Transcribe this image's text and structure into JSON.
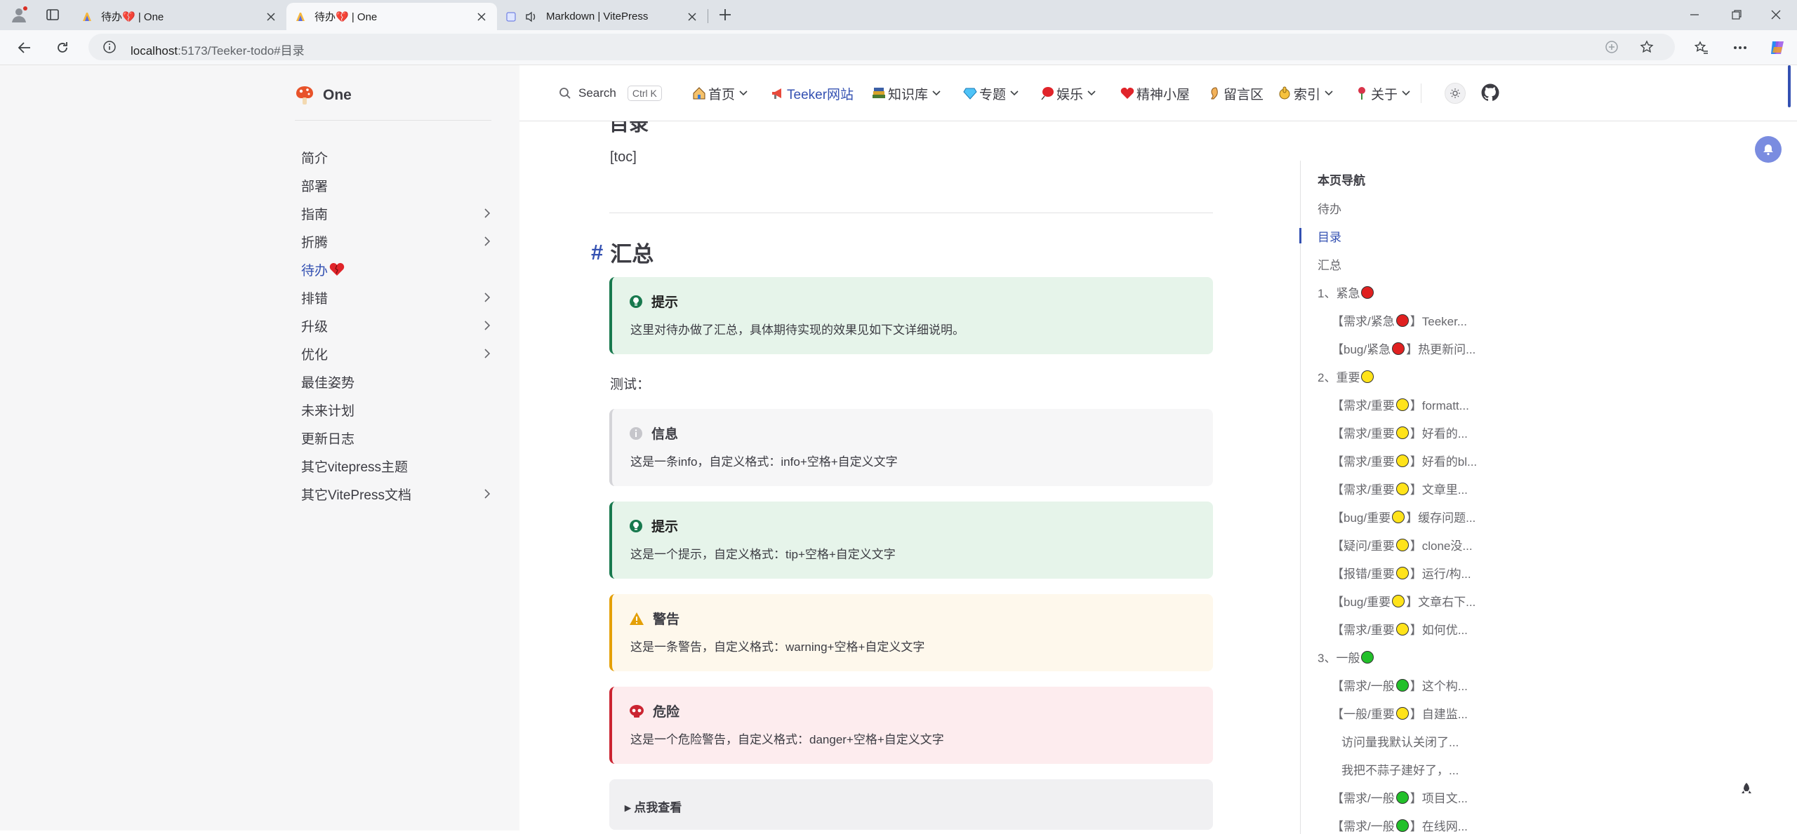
{
  "browser": {
    "tabs": [
      {
        "title": "待办💔 | One",
        "active": false
      },
      {
        "title": "待办💔 | One",
        "active": true
      },
      {
        "title": "Markdown | VitePress",
        "active": false
      }
    ],
    "address": {
      "host": "localhost",
      "path": ":5173/Teeker-todo#目录"
    }
  },
  "site": {
    "name": "One",
    "search_label": "Search",
    "search_kbd": "Ctrl K"
  },
  "nav": [
    {
      "label": "首页",
      "caret": true
    },
    {
      "label": "Teeker网站",
      "caret": false
    },
    {
      "label": "知识库",
      "caret": true
    },
    {
      "label": "专题",
      "caret": true
    },
    {
      "label": "娱乐",
      "caret": true
    },
    {
      "label": "精神小屋",
      "caret": false
    },
    {
      "label": "留言区",
      "caret": false
    },
    {
      "label": "索引",
      "caret": true
    },
    {
      "label": "关于",
      "caret": true
    }
  ],
  "sidebar": [
    {
      "label": "简介",
      "chevron": false
    },
    {
      "label": "部署",
      "chevron": false
    },
    {
      "label": "指南",
      "chevron": true
    },
    {
      "label": "折腾",
      "chevron": true
    },
    {
      "label": "待办",
      "chevron": false,
      "active": true
    },
    {
      "label": "排错",
      "chevron": true
    },
    {
      "label": "升级",
      "chevron": true
    },
    {
      "label": "优化",
      "chevron": true
    },
    {
      "label": "最佳姿势",
      "chevron": false
    },
    {
      "label": "未来计划",
      "chevron": false
    },
    {
      "label": "更新日志",
      "chevron": false
    },
    {
      "label": "其它vitepress主题",
      "chevron": false
    },
    {
      "label": "其它VitePress文档",
      "chevron": true
    }
  ],
  "content": {
    "partial_heading": "目录",
    "toc_placeholder": "[toc]",
    "section_hash": "#",
    "section_title": "汇总",
    "summary_tip": {
      "title": "提示",
      "text": "这里对待办做了汇总，具体期待实现的效果见如下文详细说明。"
    },
    "test_label": "测试：",
    "info": {
      "title": "信息",
      "text": "这是一条info，自定义格式：info+空格+自定义文字"
    },
    "tip": {
      "title": "提示",
      "text": "这是一个提示，自定义格式：tip+空格+自定义文字"
    },
    "warning": {
      "title": "警告",
      "text": "这是一条警告，自定义格式：warning+空格+自定义文字"
    },
    "danger": {
      "title": "危险",
      "text": "这是一个危险警告，自定义格式：danger+空格+自定义文字"
    },
    "details_label": "点我查看"
  },
  "outline": {
    "title": "本页导航",
    "items": [
      {
        "pre": "待办",
        "dot": "",
        "post": "",
        "level": 1
      },
      {
        "pre": "目录",
        "dot": "",
        "post": "",
        "level": 1,
        "active": true
      },
      {
        "pre": "汇总",
        "dot": "",
        "post": "",
        "level": 1
      },
      {
        "pre": "1、紧急",
        "dot": "red",
        "post": "",
        "level": 1
      },
      {
        "pre": "【需求/紧急",
        "dot": "red",
        "post": "】Teeker...",
        "level": 2
      },
      {
        "pre": "【bug/紧急",
        "dot": "red",
        "post": "】热更新问...",
        "level": 2
      },
      {
        "pre": "2、重要",
        "dot": "yellow",
        "post": "",
        "level": 1
      },
      {
        "pre": "【需求/重要",
        "dot": "yellow",
        "post": "】formatt...",
        "level": 2
      },
      {
        "pre": "【需求/重要",
        "dot": "yellow",
        "post": "】好看的...",
        "level": 2
      },
      {
        "pre": "【需求/重要",
        "dot": "yellow",
        "post": "】好看的bl...",
        "level": 2
      },
      {
        "pre": "【需求/重要",
        "dot": "yellow",
        "post": "】文章里...",
        "level": 2
      },
      {
        "pre": "【bug/重要",
        "dot": "yellow",
        "post": "】缓存问题...",
        "level": 2
      },
      {
        "pre": "【疑问/重要",
        "dot": "yellow",
        "post": "】clone没...",
        "level": 2
      },
      {
        "pre": "【报错/重要",
        "dot": "yellow",
        "post": "】运行/构...",
        "level": 2
      },
      {
        "pre": "【bug/重要",
        "dot": "yellow",
        "post": "】文章右下...",
        "level": 2
      },
      {
        "pre": "【需求/重要",
        "dot": "yellow",
        "post": "】如何优...",
        "level": 2
      },
      {
        "pre": "3、一般",
        "dot": "green",
        "post": "",
        "level": 1
      },
      {
        "pre": "【需求/一般",
        "dot": "green",
        "post": "】这个构...",
        "level": 2
      },
      {
        "pre": "【一般/重要",
        "dot": "yellow",
        "post": "】自建监...",
        "level": 2
      },
      {
        "pre": "访问量我默认关闭了...",
        "dot": "",
        "post": "",
        "level": 3
      },
      {
        "pre": "我把不蒜子建好了，...",
        "dot": "",
        "post": "",
        "level": 3
      },
      {
        "pre": "【需求/一般",
        "dot": "green",
        "post": "】项目文...",
        "level": 2
      },
      {
        "pre": "【需求/一般",
        "dot": "green",
        "post": "】在线网...",
        "level": 2
      }
    ]
  },
  "colors": {
    "brand": "#3451b2",
    "tip": "#18794e",
    "warning": "#e4a007",
    "danger": "#cb2431"
  }
}
